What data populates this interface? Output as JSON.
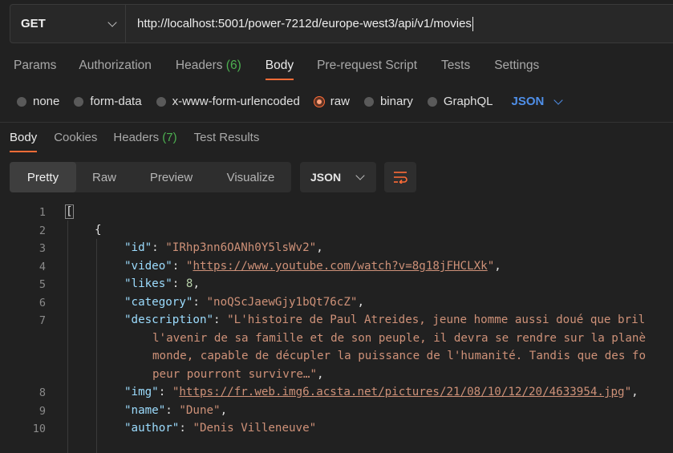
{
  "request": {
    "method": "GET",
    "url": "http://localhost:5001/power-7212d/europe-west3/api/v1/movies"
  },
  "request_tabs": [
    {
      "label": "Params",
      "count": ""
    },
    {
      "label": "Authorization",
      "count": ""
    },
    {
      "label": "Headers",
      "count": "(6)"
    },
    {
      "label": "Body",
      "count": ""
    },
    {
      "label": "Pre-request Script",
      "count": ""
    },
    {
      "label": "Tests",
      "count": ""
    },
    {
      "label": "Settings",
      "count": ""
    }
  ],
  "body_types": [
    "none",
    "form-data",
    "x-www-form-urlencoded",
    "raw",
    "binary",
    "GraphQL"
  ],
  "body_format": "JSON",
  "response_tabs": [
    {
      "label": "Body",
      "count": ""
    },
    {
      "label": "Cookies",
      "count": ""
    },
    {
      "label": "Headers",
      "count": "(7)"
    },
    {
      "label": "Test Results",
      "count": ""
    }
  ],
  "view_modes": [
    "Pretty",
    "Raw",
    "Preview",
    "Visualize"
  ],
  "response_format": "JSON",
  "code": {
    "line_numbers": [
      "1",
      "2",
      "3",
      "4",
      "5",
      "6",
      "7",
      "8",
      "9",
      "10"
    ],
    "open_array": "[",
    "open_object": "{",
    "id_key": "\"id\"",
    "id_value": "\"IRhp3nn6OANh0Y5lsWv2\"",
    "video_key": "\"video\"",
    "video_value": "https://www.youtube.com/watch?v=8g18jFHCLXk",
    "likes_key": "\"likes\"",
    "likes_value": "8",
    "category_key": "\"category\"",
    "category_value": "\"noQScJaewGjy1bQt76cZ\"",
    "description_key": "\"description\"",
    "description_lines": [
      "\"L'histoire de Paul Atreides, jeune homme aussi doué que bril",
      "l'avenir de sa famille et de son peuple, il devra se rendre sur la planè",
      "monde, capable de décupler la puissance de l'humanité. Tandis que des fo",
      "peur pourront survivre…\""
    ],
    "img_key": "\"img\"",
    "img_value": "https://fr.web.img6.acsta.net/pictures/21/08/10/12/20/4633954.jpg",
    "name_key": "\"name\"",
    "name_value": "\"Dune\"",
    "author_key": "\"author\"",
    "author_value": "\"Denis Villeneuve\""
  },
  "colors": {
    "accent": "#ff6c37",
    "json_blue": "#4f8fe8",
    "count_green": "#4caf50"
  }
}
